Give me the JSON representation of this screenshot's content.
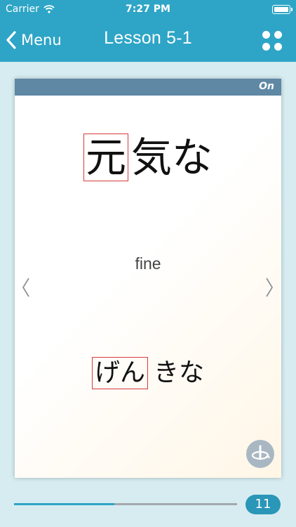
{
  "status": {
    "carrier": "Carrier",
    "time": "7:27 PM"
  },
  "nav": {
    "back_label": "Menu",
    "title": "Lesson 5-1"
  },
  "card": {
    "mode_label": "On",
    "kanji_highlight": "元",
    "kanji_rest": "気な",
    "meaning": "fine",
    "reading_highlight": "げん",
    "reading_rest": "きな"
  },
  "progress": {
    "value": 0.45,
    "card_number": "11"
  },
  "colors": {
    "accent": "#2ea5c6",
    "header": "#5e88a4",
    "highlight_box": "#d83a3a",
    "background": "#d6ecf1"
  },
  "icons": [
    "wifi-icon",
    "battery-icon",
    "chevron-left-icon",
    "grid-icon",
    "flip-icon",
    "arrow-left-icon",
    "arrow-right-icon"
  ]
}
